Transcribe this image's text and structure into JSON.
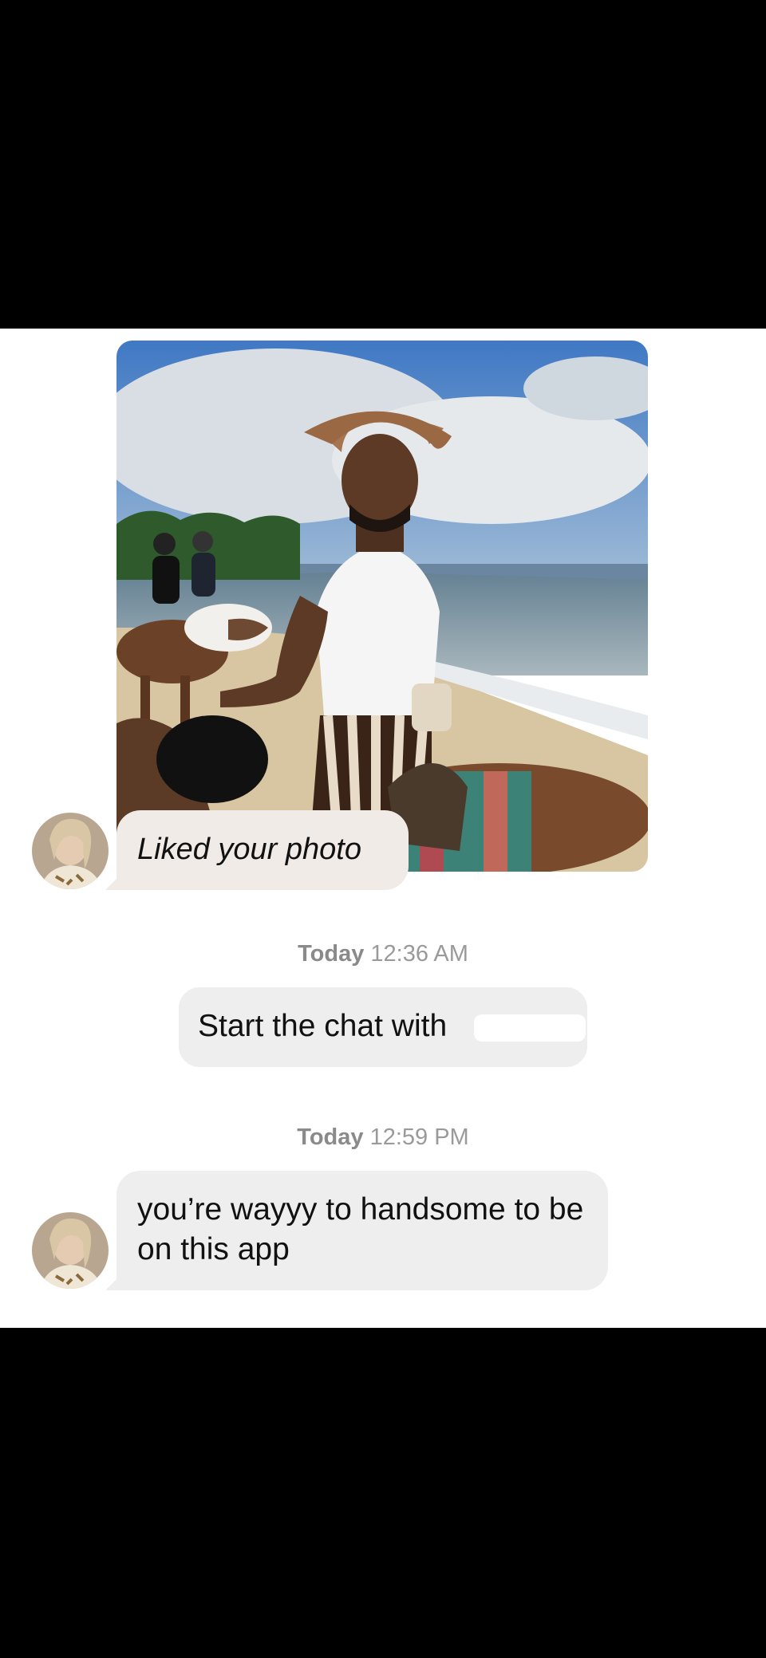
{
  "photo": {
    "description_icon": "photo-image"
  },
  "liked": {
    "text": "Liked your photo"
  },
  "timestamps": [
    {
      "day": "Today",
      "time": "12:36 AM"
    },
    {
      "day": "Today",
      "time": "12:59 PM"
    }
  ],
  "system_message": {
    "text": "Start the chat with"
  },
  "message": {
    "text": "you’re wayyy to handsome to be on this app"
  },
  "colors": {
    "chat_background": "#ffffff",
    "bubble_gray": "#eeeeee",
    "liked_bubble": "#f0ebe7",
    "timestamp": "#9a9a9a",
    "outside": "#000000"
  }
}
